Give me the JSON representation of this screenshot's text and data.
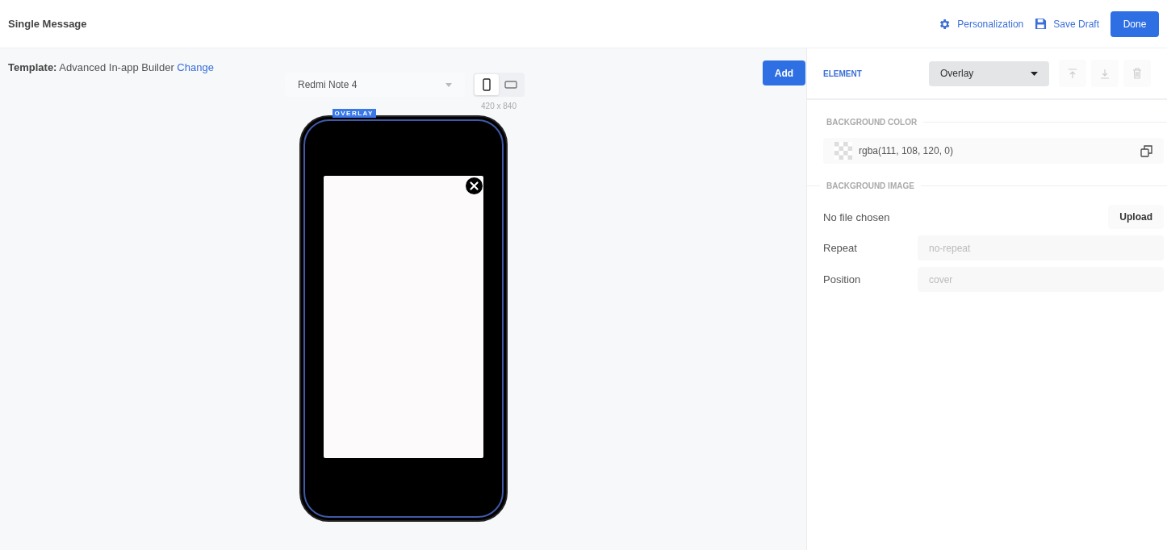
{
  "header": {
    "title": "Single Message",
    "actions": [
      {
        "kind": "personalization",
        "label": "Personalization"
      },
      {
        "kind": "save",
        "label": "Save Draft"
      }
    ],
    "done": "Done"
  },
  "canvas": {
    "template_label": "Template:",
    "template_name": "Advanced In-app Builder",
    "change_link": "Change",
    "add_button": "Add",
    "device": "Redmi Note 4",
    "orientations": [
      {
        "kind": "portrait",
        "selected": true
      },
      {
        "kind": "landscape",
        "selected": false
      }
    ],
    "resolution": "420 x 840",
    "overlay_tag": "OVERLAY"
  },
  "panel": {
    "element_label": "ELEMENT",
    "element_value": "Overlay",
    "background_color_title": "BACKGROUND COLOR",
    "color_value": "rgba(111, 108, 120, 0)",
    "background_image_title": "BACKGROUND IMAGE",
    "file_status": "No file chosen",
    "upload": "Upload",
    "fields": [
      {
        "label": "Repeat",
        "placeholder": "no-repeat"
      },
      {
        "label": "Position",
        "placeholder": "cover"
      }
    ]
  }
}
